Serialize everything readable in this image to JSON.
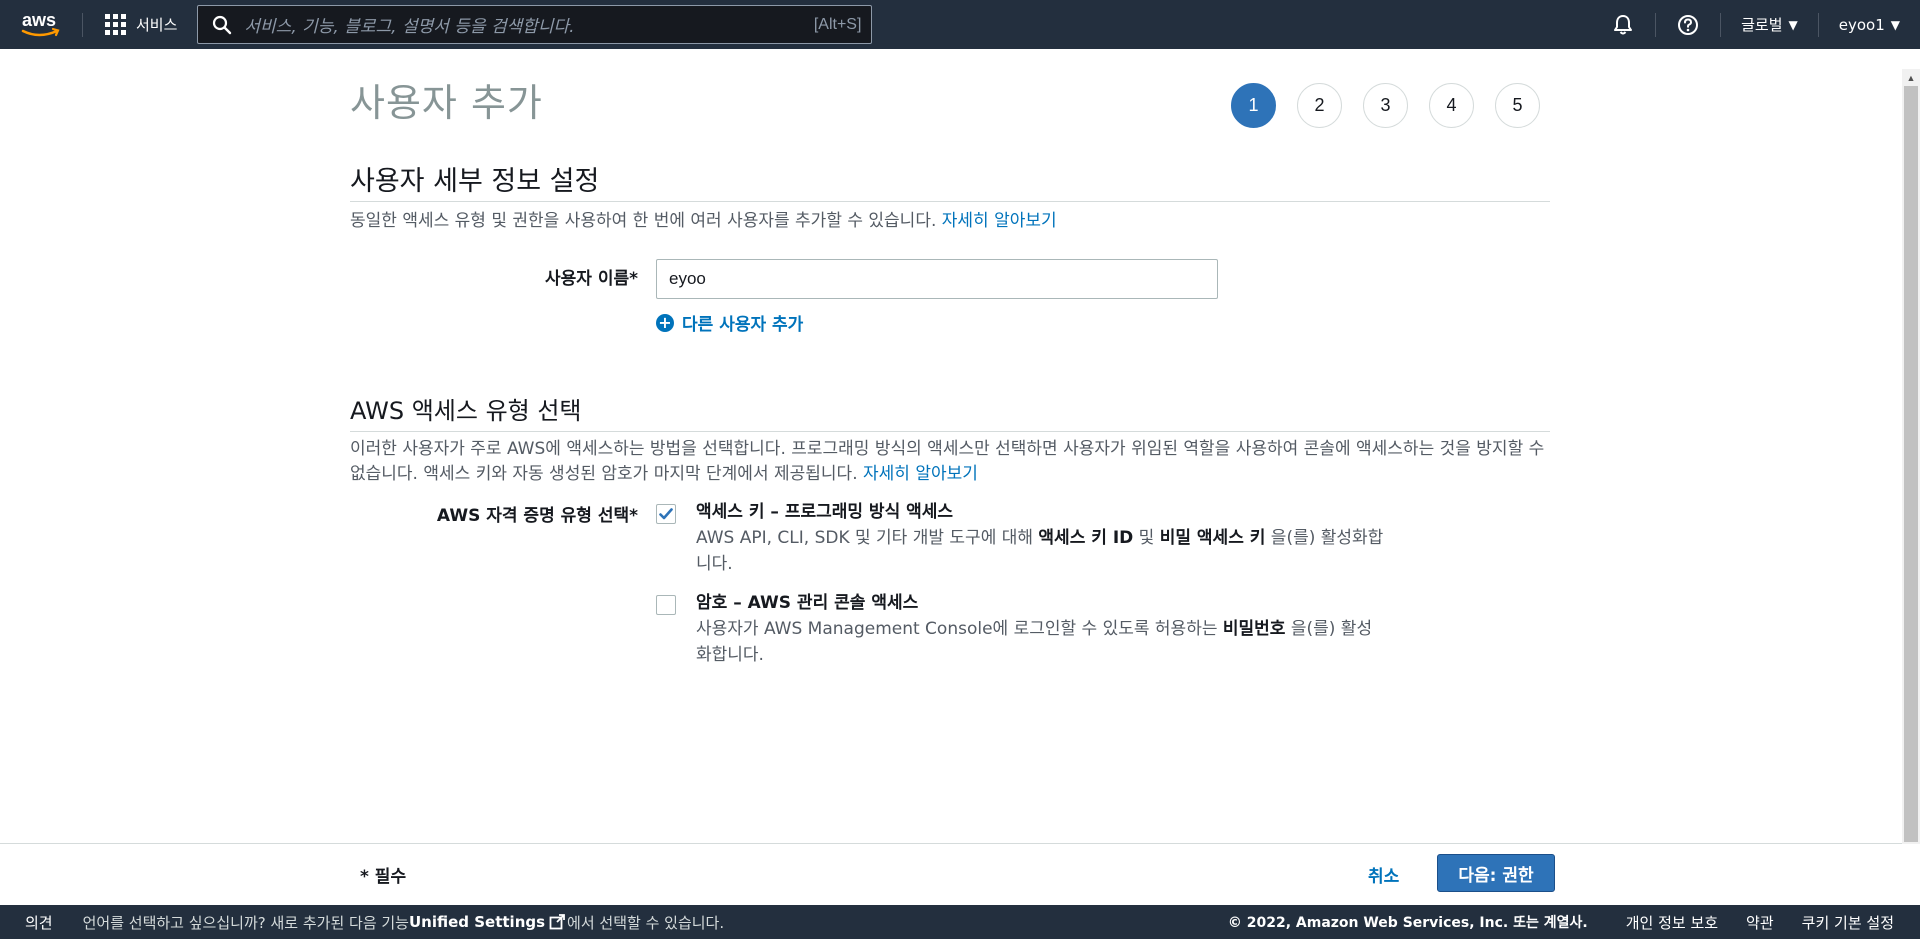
{
  "topnav": {
    "logo_text": "aws",
    "services_label": "서비스",
    "search_placeholder": "서비스, 기능, 블로그, 설명서 등을 검색합니다.",
    "search_shortcut": "[Alt+S]",
    "region_label": "글로벌",
    "account_label": "eyoo1"
  },
  "page": {
    "title": "사용자 추가",
    "steps": [
      "1",
      "2",
      "3",
      "4",
      "5"
    ],
    "active_step": "1"
  },
  "user_details": {
    "section_title": "사용자 세부 정보 설정",
    "description": "동일한 액세스 유형 및 권한을 사용하여 한 번에 여러 사용자를 추가할 수 있습니다.",
    "learn_more": "자세히 알아보기",
    "username_label": "사용자 이름*",
    "username_value": "eyoo",
    "add_another_user": "다른 사용자 추가"
  },
  "access_type": {
    "section_title": "AWS 액세스 유형 선택",
    "description": "이러한 사용자가 주로 AWS에 액세스하는 방법을 선택합니다. 프로그래밍 방식의 액세스만 선택하면 사용자가 위임된 역할을 사용하여 콘솔에 액세스하는 것을 방지할 수 없습니다. 액세스 키와 자동 생성된 암호가 마지막 단계에서 제공됩니다.",
    "learn_more": "자세히 알아보기",
    "credential_label": "AWS 자격 증명 유형 선택*",
    "options": [
      {
        "checked": true,
        "title": "액세스 키 – 프로그래밍 방식 액세스",
        "desc_1": "AWS API, CLI, SDK 및 기타 개발 도구에 대해 ",
        "desc_bold_1": "액세스 키 ID",
        "desc_2": " 및 ",
        "desc_bold_2": "비밀 액세스 키",
        "desc_3": " 을(를) 활성화합니다."
      },
      {
        "checked": false,
        "title": "암호 – AWS 관리 콘솔 액세스",
        "desc_1": "사용자가 AWS Management Console에 로그인할 수 있도록 허용하는 ",
        "desc_bold_1": "비밀번호",
        "desc_3": " 을(를) 활성화합니다."
      }
    ]
  },
  "actions": {
    "required_note": "* 필수",
    "cancel": "취소",
    "next": "다음: 권한"
  },
  "footer": {
    "feedback": "의견",
    "language_msg_1": "언어를 선택하고 싶으십니까? 새로 추가된 다음 기능",
    "unified_settings": "Unified Settings",
    "language_msg_2": "에서 선택할 수 있습니다.",
    "copyright": "© 2022, Amazon Web Services, Inc. 또는 계열사.",
    "privacy": "개인 정보 보호",
    "terms": "약관",
    "cookies": "쿠키 기본 설정"
  },
  "colors": {
    "nav_bg": "#232f3e",
    "primary": "#2e73b8",
    "link": "#0073bb"
  }
}
